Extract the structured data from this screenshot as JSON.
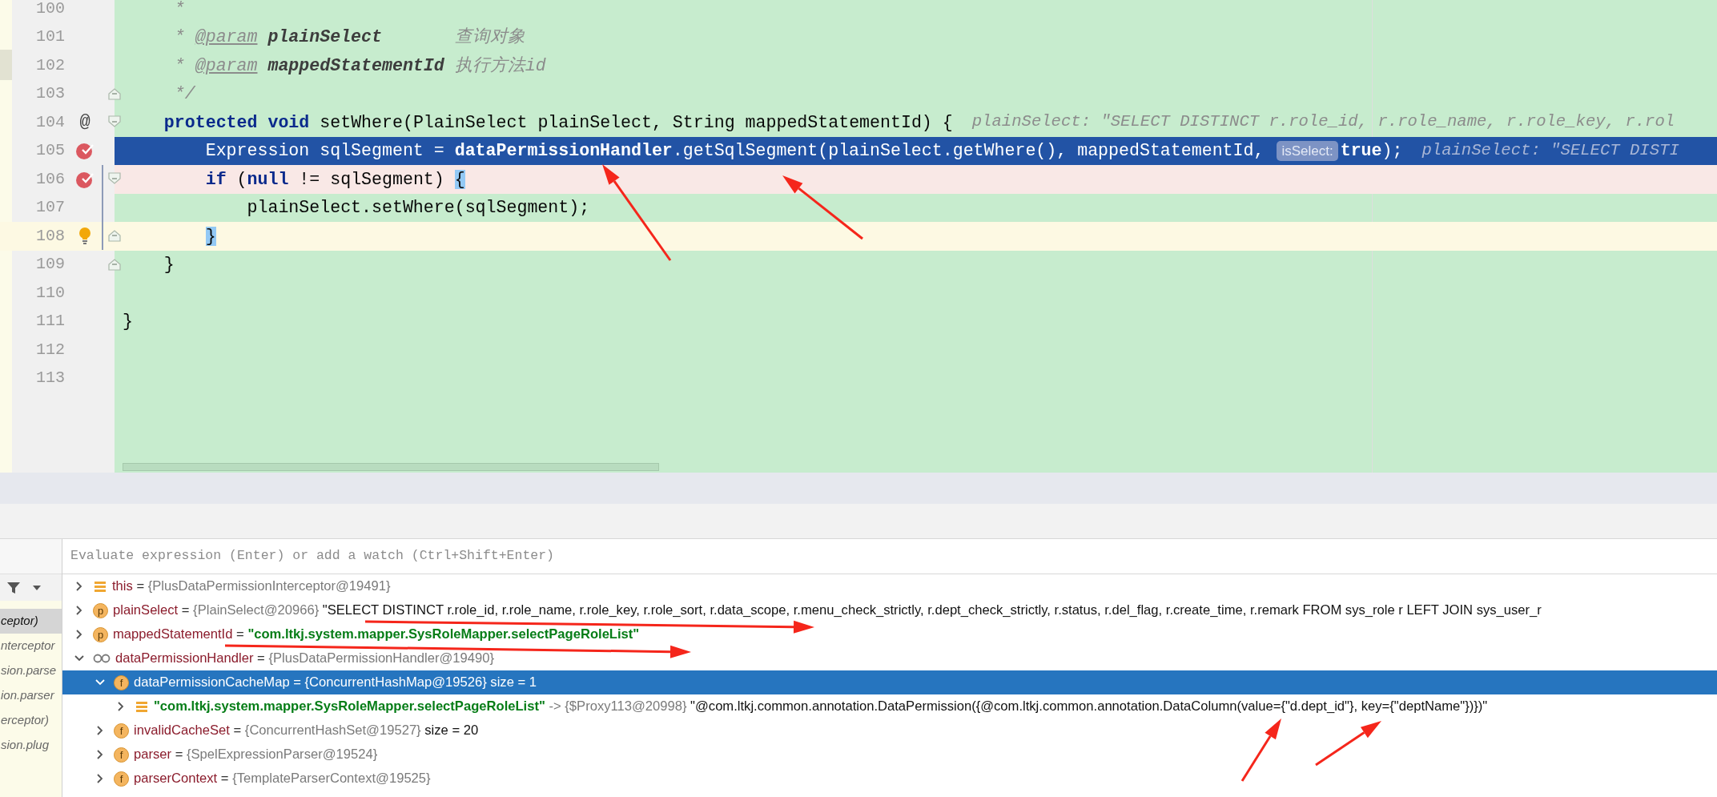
{
  "editor": {
    "lines": [
      {
        "number": "100",
        "kind": "plain",
        "tokens": [
          {
            "text": "     *",
            "kind": "comment"
          }
        ]
      },
      {
        "number": "101",
        "kind": "plain",
        "tokens": [
          {
            "text": "     * ",
            "kind": "comment"
          },
          {
            "text": "@param",
            "kind": "doc-tag"
          },
          {
            "text": " plainSelect",
            "kind": "doc-param"
          },
          {
            "text": "       查询对象",
            "kind": "comment"
          }
        ]
      },
      {
        "number": "102",
        "kind": "plain",
        "tokens": [
          {
            "text": "     * ",
            "kind": "comment"
          },
          {
            "text": "@param",
            "kind": "doc-tag"
          },
          {
            "text": " mappedStatementId",
            "kind": "doc-param"
          },
          {
            "text": " 执行方法id",
            "kind": "comment"
          }
        ]
      },
      {
        "number": "103",
        "kind": "plain",
        "fold": {
          "kind": "end"
        },
        "tokens": [
          {
            "text": "     */",
            "kind": "comment"
          }
        ]
      },
      {
        "number": "104",
        "kind": "plain",
        "fold": {
          "kind": "start"
        },
        "marker": {
          "kind": "symbol",
          "text": "@"
        },
        "tokens": [
          {
            "text": "    protected",
            "kind": "keyword"
          },
          {
            "text": " void",
            "kind": "keyword"
          },
          {
            "text": " setWhere(PlainSelect plainSelect, String mappedStatementId) {",
            "kind": "plain"
          },
          {
            "text": "plainSelect: \"SELECT DISTINCT r.role_id, r.role_name, r.role_key, r.rol",
            "kind": "hint"
          }
        ]
      },
      {
        "number": "105",
        "kind": "execution",
        "marker": {
          "kind": "breakpoint"
        },
        "tokens": [
          {
            "text": "        Expression sqlSegment = ",
            "kind": "plain"
          },
          {
            "text": "dataPermissionHandler",
            "kind": "field"
          },
          {
            "text": ".getSqlSegment(plainSelect.getWhere(), mappedStatementId, ",
            "kind": "plain"
          },
          {
            "text": "isSelect:",
            "kind": "inlay"
          },
          {
            "text": "true",
            "kind": "keyword"
          },
          {
            "text": ");",
            "kind": "plain"
          },
          {
            "text": "plainSelect: \"SELECT DISTI",
            "kind": "hint"
          }
        ]
      },
      {
        "number": "106",
        "kind": "breakpoint",
        "fold": {
          "kind": "start"
        },
        "marker": {
          "kind": "breakpoint"
        },
        "tokens": [
          {
            "text": "        if",
            "kind": "keyword"
          },
          {
            "text": " (",
            "kind": "plain"
          },
          {
            "text": "null",
            "kind": "keyword"
          },
          {
            "text": " != sqlSegment) ",
            "kind": "plain"
          },
          {
            "text": "{",
            "kind": "brace"
          }
        ]
      },
      {
        "number": "107",
        "kind": "plain",
        "tokens": [
          {
            "text": "            plainSelect.setWhere(sqlSegment);",
            "kind": "plain"
          }
        ]
      },
      {
        "number": "108",
        "kind": "caret",
        "fold": {
          "kind": "end"
        },
        "marker": {
          "kind": "bulb"
        },
        "tokens": [
          {
            "text": "        }",
            "kind": "brace"
          }
        ]
      },
      {
        "number": "109",
        "kind": "plain",
        "fold": {
          "kind": "end"
        },
        "tokens": [
          {
            "text": "    }",
            "kind": "plain"
          }
        ]
      },
      {
        "number": "110",
        "kind": "plain"
      },
      {
        "number": "111",
        "kind": "plain",
        "tokens": [
          {
            "text": "}",
            "kind": "plain"
          }
        ]
      },
      {
        "number": "112",
        "kind": "plain"
      },
      {
        "number": "113",
        "kind": "plain"
      }
    ]
  },
  "debugger": {
    "frames": [
      {
        "text": "ceptor)",
        "selected": true
      },
      {
        "text": "nterceptor",
        "selected": false
      },
      {
        "text": "sion.parse",
        "selected": false
      },
      {
        "text": "ion.parser",
        "selected": false
      },
      {
        "text": "erceptor)",
        "selected": false
      },
      {
        "text": "sion.plug",
        "selected": false
      }
    ],
    "evaluate": {
      "placeholder": "Evaluate expression (Enter) or add a watch (Ctrl+Shift+Enter)"
    },
    "variables": [
      {
        "icon": {
          "kind": "list"
        },
        "expanded": false,
        "selected": false,
        "segments": [
          {
            "text": "this",
            "kind": "name"
          },
          {
            "text": "=",
            "kind": "op"
          },
          {
            "text": "{PlusDataPermissionInterceptor@19491}",
            "kind": "ref"
          }
        ]
      },
      {
        "icon": {
          "kind": "badge",
          "letter": "p"
        },
        "expanded": false,
        "selected": false,
        "segments": [
          {
            "text": "plainSelect",
            "kind": "name"
          },
          {
            "text": "=",
            "kind": "op"
          },
          {
            "text": "{PlainSelect@20966}",
            "kind": "ref"
          },
          {
            "text": "\"SELECT DISTINCT r.role_id, r.role_name, r.role_key, r.role_sort, r.data_scope, r.menu_check_strictly, r.dept_check_strictly, r.status, r.del_flag, r.create_time, r.remark FROM sys_role r LEFT JOIN sys_user_r",
            "kind": "plain"
          }
        ]
      },
      {
        "icon": {
          "kind": "badge",
          "letter": "p"
        },
        "expanded": false,
        "selected": false,
        "segments": [
          {
            "text": "mappedStatementId",
            "kind": "name"
          },
          {
            "text": "=",
            "kind": "op"
          },
          {
            "text": "\"com.ltkj.system.mapper.SysRoleMapper.selectPageRoleList\"",
            "kind": "string"
          }
        ]
      },
      {
        "icon": {
          "kind": "watch"
        },
        "expanded": true,
        "selected": false,
        "segments": [
          {
            "text": "dataPermissionHandler",
            "kind": "name"
          },
          {
            "text": "=",
            "kind": "op"
          },
          {
            "text": "{PlusDataPermissionHandler@19490}",
            "kind": "ref"
          }
        ],
        "children": [
          {
            "icon": {
              "kind": "badge",
              "letter": "f"
            },
            "expanded": true,
            "selected": true,
            "segments": [
              {
                "text": "dataPermissionCacheMap",
                "kind": "name"
              },
              {
                "text": "=",
                "kind": "op"
              },
              {
                "text": "{ConcurrentHashMap@19526}",
                "kind": "ref"
              },
              {
                "text": " size = 1",
                "kind": "plain"
              }
            ],
            "children": [
              {
                "icon": {
                  "kind": "list"
                },
                "expanded": false,
                "selected": false,
                "segments": [
                  {
                    "text": "\"com.ltkj.system.mapper.SysRoleMapper.selectPageRoleList\"",
                    "kind": "string"
                  },
                  {
                    "text": "->",
                    "kind": "ref"
                  },
                  {
                    "text": "{$Proxy113@20998}",
                    "kind": "ref"
                  },
                  {
                    "text": "\"@com.ltkj.common.annotation.DataPermission({@com.ltkj.common.annotation.DataColumn(value={\"d.dept_id\"}, key={\"deptName\"})})\"",
                    "kind": "plain"
                  }
                ]
              }
            ]
          },
          {
            "icon": {
              "kind": "badge",
              "letter": "f"
            },
            "expanded": false,
            "selected": false,
            "segments": [
              {
                "text": "invalidCacheSet",
                "kind": "name"
              },
              {
                "text": "=",
                "kind": "op"
              },
              {
                "text": "{ConcurrentHashSet@19527}",
                "kind": "ref"
              },
              {
                "text": " size = 20",
                "kind": "plain"
              }
            ]
          },
          {
            "icon": {
              "kind": "badge",
              "letter": "f"
            },
            "expanded": false,
            "selected": false,
            "segments": [
              {
                "text": "parser",
                "kind": "name"
              },
              {
                "text": "=",
                "kind": "op"
              },
              {
                "text": "{SpelExpressionParser@19524}",
                "kind": "ref"
              }
            ]
          },
          {
            "icon": {
              "kind": "badge",
              "letter": "f"
            },
            "expanded": false,
            "selected": false,
            "segments": [
              {
                "text": "parserContext",
                "kind": "name"
              },
              {
                "text": "=",
                "kind": "op"
              },
              {
                "text": "{TemplateParserContext@19525}",
                "kind": "ref"
              }
            ]
          }
        ]
      }
    ]
  }
}
